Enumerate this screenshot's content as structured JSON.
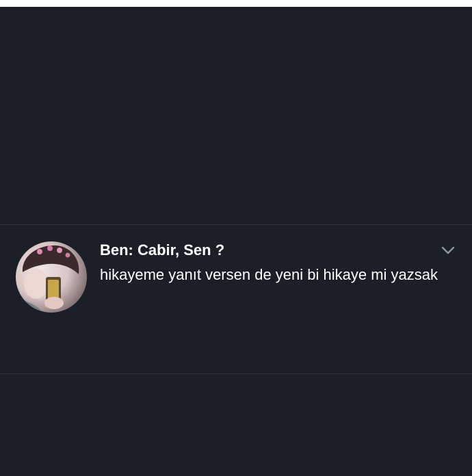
{
  "tweet": {
    "title": "Ben: Cabir, Sen ?",
    "text": "hikayeme yanıt versen de yeni bi hikaye mi yazsak",
    "menu_icon": "chevron-down-icon"
  }
}
